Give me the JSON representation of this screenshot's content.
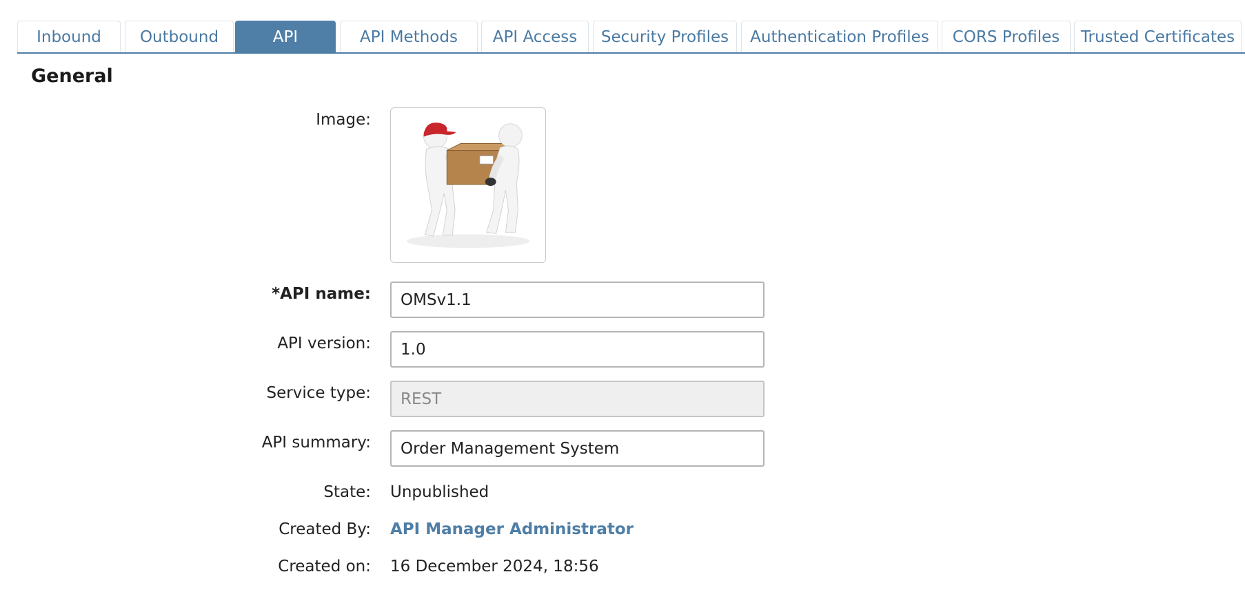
{
  "tabs": [
    {
      "label": "Inbound",
      "active": false
    },
    {
      "label": "Outbound",
      "active": false
    },
    {
      "label": "API",
      "active": true
    },
    {
      "label": "API Methods",
      "active": false
    },
    {
      "label": "API Access",
      "active": false
    },
    {
      "label": "Security Profiles",
      "active": false
    },
    {
      "label": "Authentication Profiles",
      "active": false
    },
    {
      "label": "CORS Profiles",
      "active": false
    },
    {
      "label": "Trusted Certificates",
      "active": false
    }
  ],
  "general": {
    "title": "General",
    "image_label": "Image:",
    "image_icon": "delivery-people-box-image",
    "api_name_label": "*API name:",
    "api_name_value": "OMSv1.1",
    "api_version_label": "API version:",
    "api_version_value": "1.0",
    "service_type_label": "Service type:",
    "service_type_value": "REST",
    "api_summary_label": "API summary:",
    "api_summary_value": "Order Management System",
    "state_label": "State:",
    "state_value": "Unpublished",
    "created_by_label": "Created By:",
    "created_by_value": "API Manager Administrator",
    "created_on_label": "Created on:",
    "created_on_value": "16 December 2024, 18:56"
  },
  "colors": {
    "accent": "#4f7ea6",
    "tab_text": "#4a7aa3",
    "field_border": "#b5b5b5",
    "disabled_bg": "#efefef"
  }
}
